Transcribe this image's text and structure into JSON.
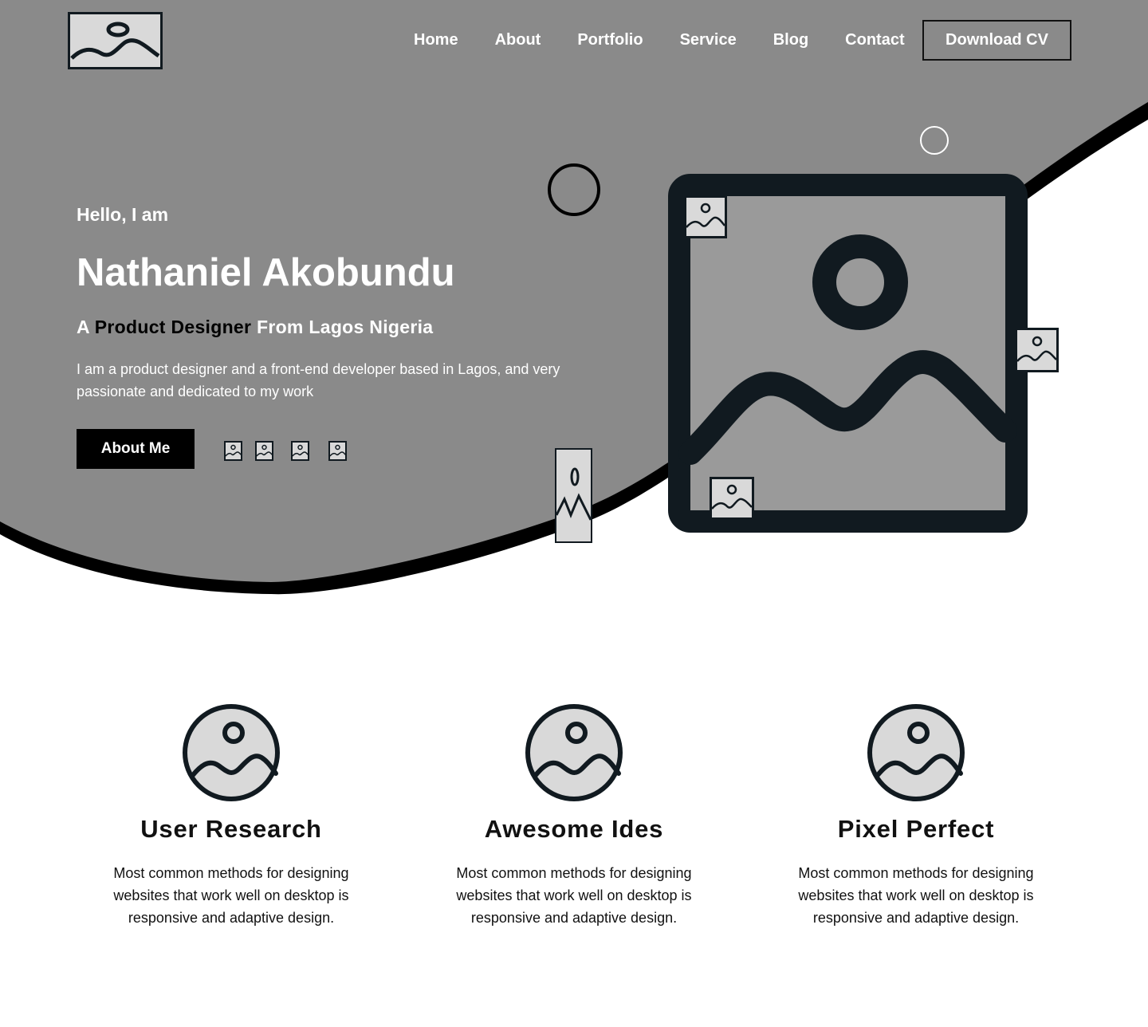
{
  "header": {
    "logo_icon": "image-placeholder-icon",
    "nav": [
      "Home",
      "About",
      "Portfolio",
      "Service",
      "Blog",
      "Contact"
    ],
    "cta_label": "Download CV"
  },
  "hero": {
    "greeting": "Hello, I am",
    "name": "Nathaniel Akobundu",
    "role_prefix": "A",
    "role_highlight": "Product Designer",
    "role_suffix": "From Lagos Nigeria",
    "intro": "I am a product designer and a front-end developer based in Lagos, and very passionate and dedicated to my work",
    "about_button": "About Me",
    "social_icons": [
      "image-placeholder-icon",
      "image-placeholder-icon",
      "image-placeholder-icon",
      "image-placeholder-icon"
    ],
    "hero_image_icon": "image-placeholder-icon"
  },
  "services": [
    {
      "icon": "image-placeholder-icon",
      "title": "User Research",
      "description": "Most common methods for designing websites that work well on desktop is responsive and adaptive design."
    },
    {
      "icon": "image-placeholder-icon",
      "title": "Awesome Ides",
      "description": "Most common methods for designing websites that work well on desktop is responsive and adaptive design."
    },
    {
      "icon": "image-placeholder-icon",
      "title": "Pixel Perfect",
      "description": "Most common methods for designing websites that work well on desktop is responsive and adaptive design."
    }
  ],
  "colors": {
    "hero_bg": "#8a8a8a",
    "dark": "#111a20",
    "placeholder_fill": "#d9d9d9",
    "hero_image_fill": "#9a9a9a",
    "text_light": "#ffffff",
    "text_dark": "#111111"
  }
}
